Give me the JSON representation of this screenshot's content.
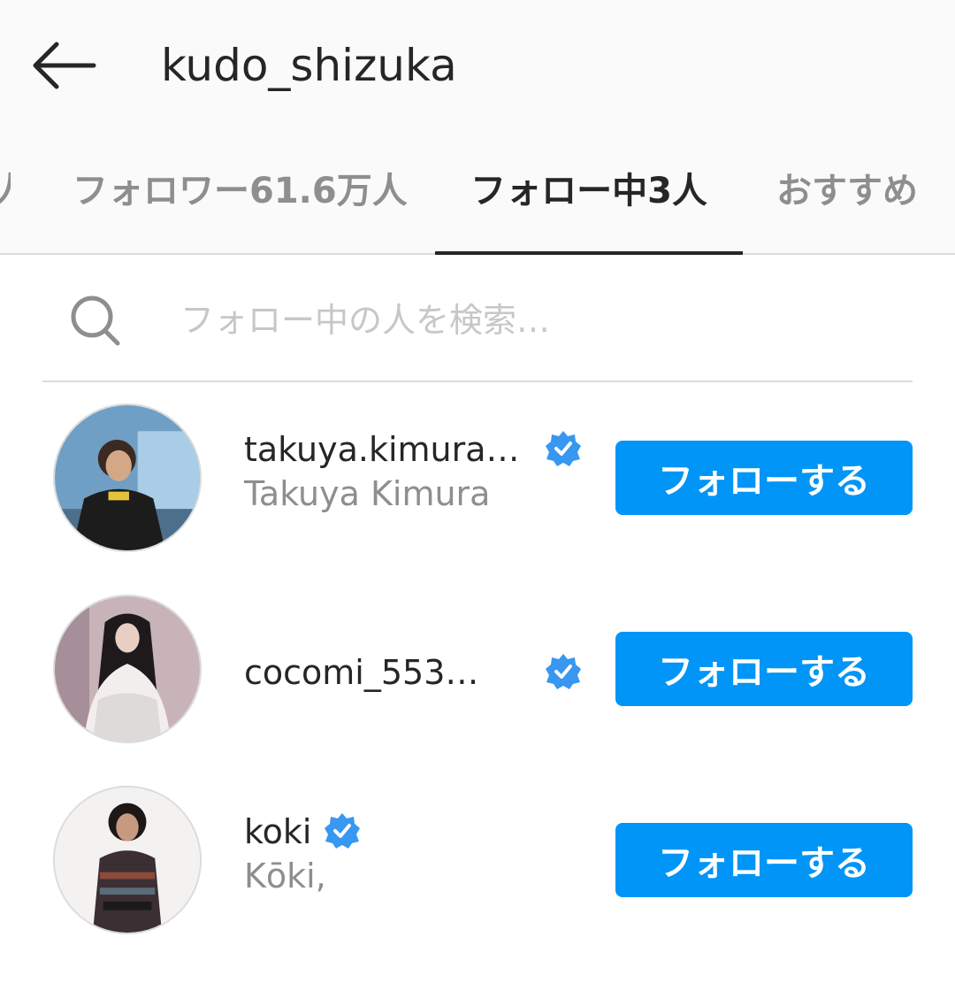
{
  "header": {
    "title": "kudo_shizuka",
    "back_icon": "arrow-left-icon"
  },
  "tabs": {
    "prev_partial": "人",
    "followers": "フォロワー61.6万人",
    "following": "フォロー中3人",
    "suggested": "おすすめ"
  },
  "search": {
    "placeholder": "フォロー中の人を検索…",
    "value": "",
    "icon": "search-icon"
  },
  "users": [
    {
      "username": "takuya.kimura…",
      "full_name": "Takuya Kimura",
      "verified": true,
      "button_label": "フォローする"
    },
    {
      "username": "cocomi_553…",
      "full_name": "",
      "verified": true,
      "button_label": "フォローする"
    },
    {
      "username": "koki",
      "full_name": "Kōki,",
      "verified": true,
      "button_label": "フォローする"
    }
  ],
  "colors": {
    "accent": "#0095f6",
    "text_primary": "#262626",
    "text_secondary": "#8e8e8e",
    "divider": "#dbdbdb",
    "header_bg": "#fafafa"
  }
}
